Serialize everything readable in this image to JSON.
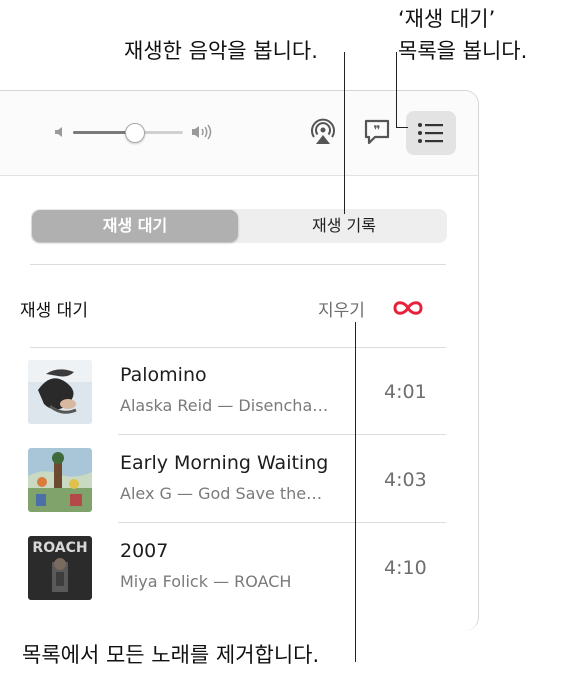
{
  "callouts": {
    "history": "재생한 음악을 봅니다.",
    "queue_line1": "‘재생 대기’",
    "queue_line2": "목록을 봅니다.",
    "clear": "목록에서 모든 노래를 제거합니다."
  },
  "segmented": {
    "queue": "재생 대기",
    "history": "재생 기록"
  },
  "queue": {
    "title": "재생 대기",
    "clear_label": "지우기"
  },
  "volume_level": 0.55,
  "tracks": [
    {
      "title": "Palomino",
      "subtitle": "Alaska Reid — Disencha…",
      "duration": "4:01"
    },
    {
      "title": "Early Morning Waiting",
      "subtitle": "Alex G — God Save the…",
      "duration": "4:03"
    },
    {
      "title": "2007",
      "subtitle": "Miya Folick — ROACH",
      "duration": "4:10"
    }
  ],
  "album_art": {
    "roach_text": "ROACH"
  },
  "colors": {
    "infinity": "#e5243b",
    "segment_active": "#b0b0b0"
  }
}
